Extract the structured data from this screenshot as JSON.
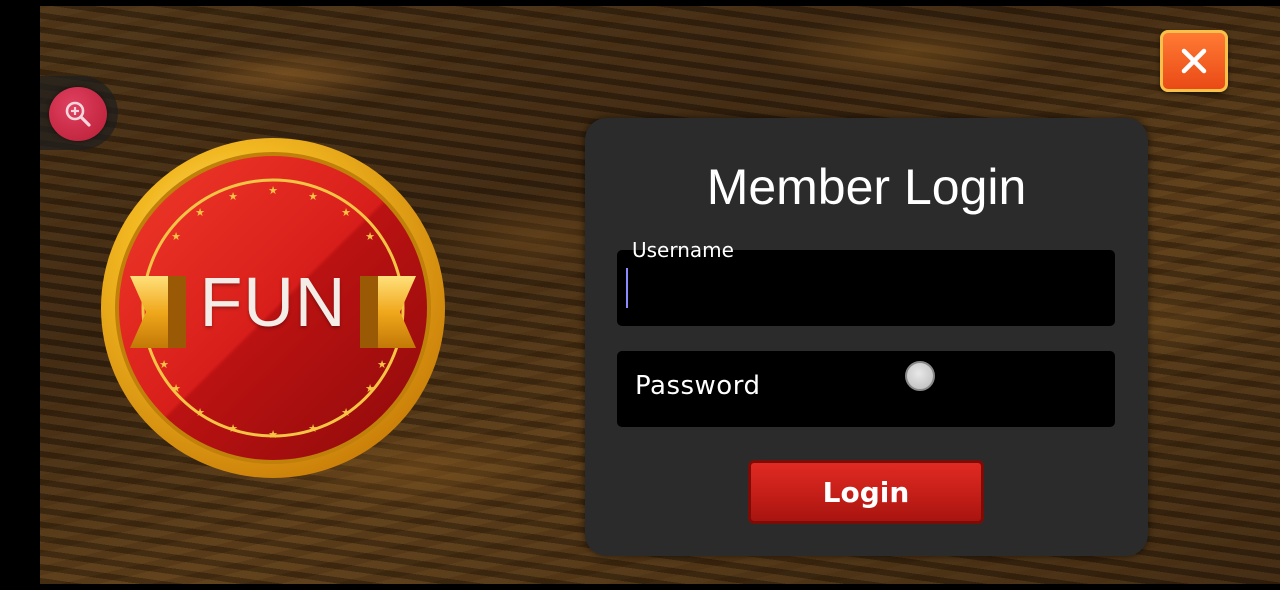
{
  "logo": {
    "text": "FUN"
  },
  "zoom": {
    "icon": "zoom-in-icon"
  },
  "close": {
    "icon": "close-icon"
  },
  "login_panel": {
    "title": "Member Login",
    "username": {
      "label": "Username",
      "value": ""
    },
    "password": {
      "placeholder": "Password",
      "value": ""
    },
    "login_button": "Login"
  },
  "colors": {
    "panel_bg": "#2b2b2c",
    "button_red": "#c41e18",
    "close_orange": "#ea4a16",
    "gold": "#f8c24a"
  }
}
